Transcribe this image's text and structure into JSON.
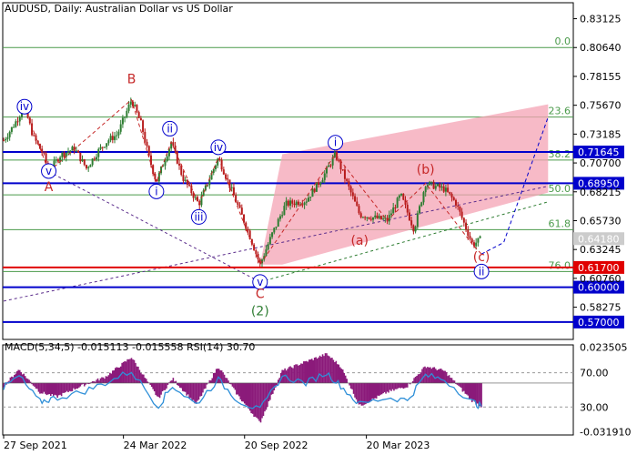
{
  "header": {
    "symbol_line": "AUDUSD, Daily:  Australian Dollar vs US Dollar",
    "indicator_line": "MACD(5,34,5) -0.015113 -0.015558 RSI(14) 30.70"
  },
  "colors": {
    "candle_up": "#2e7d32",
    "candle_down": "#b71c1c",
    "blue_level": "#0000cc",
    "red_level": "#e00000",
    "fib_level": "#4a9a4a",
    "channel": "#f4a3b4",
    "wave_blue": "#0000cc",
    "wave_red": "#c62828",
    "wave_green": "#2e7d32",
    "macd_hist": "#8b1a7a",
    "rsi_line": "#2e8fd8"
  },
  "chart_data": {
    "type": "candlestick",
    "title": "AUDUSD, Daily:  Australian Dollar vs US Dollar",
    "ylim": [
      0.555,
      0.845
    ],
    "y_ticks": [
      "0.83125",
      "0.80640",
      "0.78155",
      "0.75670",
      "0.73185",
      "0.70700",
      "0.68215",
      "0.65730",
      "0.63245",
      "0.60760",
      "0.58275"
    ],
    "x_ticks": [
      "27 Sep 2021",
      "24 Mar 2022",
      "20 Sep 2022",
      "20 Mar 2023"
    ],
    "x_range": [
      "2021-09-27",
      "2023-09-15"
    ],
    "current_price": "0.64180",
    "blue_levels": [
      "0.71645",
      "0.68950",
      "0.60000",
      "0.57000"
    ],
    "red_levels": [
      "0.61700"
    ],
    "fib_levels": [
      {
        "label": "0.0",
        "value": 0.8064
      },
      {
        "label": "23.6",
        "value": 0.7465
      },
      {
        "label": "38.2",
        "value": 0.7095
      },
      {
        "label": "50.0",
        "value": 0.6795
      },
      {
        "label": "61.8",
        "value": 0.6495
      },
      {
        "label": "76.0",
        "value": 0.6135
      }
    ],
    "wave_labels": [
      {
        "text": "iv",
        "date": "2021-10-28",
        "price": 0.7555,
        "style": "circle-blue"
      },
      {
        "text": "v",
        "date": "2021-12-03",
        "price": 0.7,
        "style": "circle-blue"
      },
      {
        "text": "A",
        "date": "2021-12-03",
        "price": 0.6865,
        "style": "red"
      },
      {
        "text": "B",
        "date": "2022-04-05",
        "price": 0.7795,
        "style": "red"
      },
      {
        "text": "ii",
        "date": "2022-06-01",
        "price": 0.7365,
        "style": "circle-blue"
      },
      {
        "text": "i",
        "date": "2022-05-12",
        "price": 0.6825,
        "style": "circle-blue"
      },
      {
        "text": "iv",
        "date": "2022-08-12",
        "price": 0.7205,
        "style": "circle-blue"
      },
      {
        "text": "iii",
        "date": "2022-07-14",
        "price": 0.6605,
        "style": "circle-blue"
      },
      {
        "text": "v",
        "date": "2022-10-13",
        "price": 0.6045,
        "style": "circle-blue"
      },
      {
        "text": "C",
        "date": "2022-10-13",
        "price": 0.5945,
        "style": "red"
      },
      {
        "text": "(2)",
        "date": "2022-10-13",
        "price": 0.5795,
        "style": "green"
      },
      {
        "text": "i",
        "date": "2023-02-02",
        "price": 0.7245,
        "style": "circle-blue"
      },
      {
        "text": "(a)",
        "date": "2023-03-10",
        "price": 0.6405,
        "style": "red"
      },
      {
        "text": "(b)",
        "date": "2023-06-16",
        "price": 0.7015,
        "style": "red"
      },
      {
        "text": "(c)",
        "date": "2023-09-07",
        "price": 0.6265,
        "style": "red"
      },
      {
        "text": "ii",
        "date": "2023-09-07",
        "price": 0.6135,
        "style": "circle-blue"
      }
    ],
    "wave_path": [
      {
        "date": "2021-10-28",
        "price": 0.7555
      },
      {
        "date": "2021-12-03",
        "price": 0.6995
      },
      {
        "date": "2022-04-05",
        "price": 0.7615
      },
      {
        "date": "2022-05-12",
        "price": 0.6905
      },
      {
        "date": "2022-06-03",
        "price": 0.725
      },
      {
        "date": "2022-07-14",
        "price": 0.6715
      },
      {
        "date": "2022-08-12",
        "price": 0.7115
      },
      {
        "date": "2022-10-13",
        "price": 0.6195
      },
      {
        "date": "2023-02-02",
        "price": 0.7145
      },
      {
        "date": "2023-04-20",
        "price": 0.6575
      },
      {
        "date": "2023-06-16",
        "price": 0.6895
      },
      {
        "date": "2023-08-25",
        "price": 0.6365
      },
      {
        "date": "2023-09-07",
        "price": 0.6285
      }
    ],
    "projection_path": [
      {
        "date": "2023-09-07",
        "price": 0.6285
      },
      {
        "date": "2023-10-10",
        "price": 0.6385
      },
      {
        "date": "2023-12-15",
        "price": 0.7465
      }
    ],
    "channel": [
      {
        "date": "2022-10-13",
        "price": 0.6195
      },
      {
        "date": "2022-11-15",
        "price": 0.7145
      },
      {
        "date": "2023-12-15",
        "price": 0.7575
      },
      {
        "date": "2023-12-15",
        "price": 0.6815
      },
      {
        "date": "2022-11-15",
        "price": 0.6195
      }
    ],
    "trend_lines": [
      {
        "from": {
          "date": "2021-09-27",
          "price": 0.588
        },
        "to": {
          "date": "2023-12-15",
          "price": 0.687
        }
      },
      {
        "from": {
          "date": "2022-10-13",
          "price": 0.6045
        },
        "to": {
          "date": "2023-12-15",
          "price": 0.6735
        }
      },
      {
        "from": {
          "date": "2021-12-03",
          "price": 0.6995
        },
        "to": {
          "date": "2022-10-13",
          "price": 0.6045
        }
      }
    ],
    "price_series": [
      {
        "date": "2021-09-27",
        "price": 0.7265
      },
      {
        "date": "2021-10-12",
        "price": 0.7395
      },
      {
        "date": "2021-10-28",
        "price": 0.7555
      },
      {
        "date": "2021-11-10",
        "price": 0.7295
      },
      {
        "date": "2021-11-25",
        "price": 0.7145
      },
      {
        "date": "2021-12-03",
        "price": 0.6995
      },
      {
        "date": "2021-12-20",
        "price": 0.7135
      },
      {
        "date": "2022-01-10",
        "price": 0.7195
      },
      {
        "date": "2022-01-28",
        "price": 0.7025
      },
      {
        "date": "2022-02-15",
        "price": 0.7175
      },
      {
        "date": "2022-03-01",
        "price": 0.7265
      },
      {
        "date": "2022-03-15",
        "price": 0.7315
      },
      {
        "date": "2022-04-05",
        "price": 0.7615
      },
      {
        "date": "2022-04-20",
        "price": 0.7395
      },
      {
        "date": "2022-05-01",
        "price": 0.7115
      },
      {
        "date": "2022-05-12",
        "price": 0.6905
      },
      {
        "date": "2022-06-03",
        "price": 0.725
      },
      {
        "date": "2022-06-20",
        "price": 0.6945
      },
      {
        "date": "2022-07-14",
        "price": 0.6715
      },
      {
        "date": "2022-08-12",
        "price": 0.7115
      },
      {
        "date": "2022-08-31",
        "price": 0.6845
      },
      {
        "date": "2022-09-25",
        "price": 0.6485
      },
      {
        "date": "2022-10-13",
        "price": 0.6195
      },
      {
        "date": "2022-10-30",
        "price": 0.6445
      },
      {
        "date": "2022-11-20",
        "price": 0.6715
      },
      {
        "date": "2022-12-20",
        "price": 0.6745
      },
      {
        "date": "2023-01-15",
        "price": 0.6955
      },
      {
        "date": "2023-02-02",
        "price": 0.7145
      },
      {
        "date": "2023-02-20",
        "price": 0.6885
      },
      {
        "date": "2023-03-10",
        "price": 0.6625
      },
      {
        "date": "2023-04-20",
        "price": 0.6575
      },
      {
        "date": "2023-05-10",
        "price": 0.6795
      },
      {
        "date": "2023-05-30",
        "price": 0.6495
      },
      {
        "date": "2023-06-16",
        "price": 0.6895
      },
      {
        "date": "2023-07-14",
        "price": 0.6845
      },
      {
        "date": "2023-07-31",
        "price": 0.6725
      },
      {
        "date": "2023-08-25",
        "price": 0.6365
      },
      {
        "date": "2023-09-07",
        "price": 0.6418
      }
    ]
  },
  "indicator_data": {
    "ylim": [
      -0.034,
      0.025
    ],
    "y_ticks": [
      "0.023505",
      "-0.031910"
    ],
    "rsi_levels": [
      "70.00",
      "30.00"
    ],
    "macd_series": [
      {
        "date": "2021-09-27",
        "v": -0.002
      },
      {
        "date": "2021-10-20",
        "v": 0.009
      },
      {
        "date": "2021-11-20",
        "v": -0.006
      },
      {
        "date": "2021-12-15",
        "v": -0.009
      },
      {
        "date": "2022-01-20",
        "v": -0.002
      },
      {
        "date": "2022-02-25",
        "v": 0.004
      },
      {
        "date": "2022-04-05",
        "v": 0.017
      },
      {
        "date": "2022-05-15",
        "v": -0.01
      },
      {
        "date": "2022-06-05",
        "v": 0.003
      },
      {
        "date": "2022-07-10",
        "v": -0.014
      },
      {
        "date": "2022-08-12",
        "v": 0.011
      },
      {
        "date": "2022-09-10",
        "v": -0.008
      },
      {
        "date": "2022-10-13",
        "v": -0.026
      },
      {
        "date": "2022-11-15",
        "v": 0.008
      },
      {
        "date": "2022-12-20",
        "v": 0.014
      },
      {
        "date": "2023-01-20",
        "v": 0.019
      },
      {
        "date": "2023-02-10",
        "v": 0.011
      },
      {
        "date": "2023-03-10",
        "v": -0.015
      },
      {
        "date": "2023-04-20",
        "v": -0.006
      },
      {
        "date": "2023-05-20",
        "v": -0.002
      },
      {
        "date": "2023-06-16",
        "v": 0.011
      },
      {
        "date": "2023-07-14",
        "v": 0.008
      },
      {
        "date": "2023-08-25",
        "v": -0.012
      },
      {
        "date": "2023-09-07",
        "v": -0.0151
      }
    ],
    "rsi_series": [
      {
        "date": "2021-09-27",
        "v": 52
      },
      {
        "date": "2021-10-20",
        "v": 66
      },
      {
        "date": "2021-11-20",
        "v": 36
      },
      {
        "date": "2021-12-10",
        "v": 40
      },
      {
        "date": "2022-01-20",
        "v": 47
      },
      {
        "date": "2022-02-25",
        "v": 58
      },
      {
        "date": "2022-04-05",
        "v": 72
      },
      {
        "date": "2022-05-15",
        "v": 31
      },
      {
        "date": "2022-06-05",
        "v": 55
      },
      {
        "date": "2022-07-10",
        "v": 33
      },
      {
        "date": "2022-08-12",
        "v": 62
      },
      {
        "date": "2022-09-10",
        "v": 38
      },
      {
        "date": "2022-10-13",
        "v": 26
      },
      {
        "date": "2022-11-15",
        "v": 66
      },
      {
        "date": "2022-12-20",
        "v": 58
      },
      {
        "date": "2023-01-20",
        "v": 70
      },
      {
        "date": "2023-02-10",
        "v": 55
      },
      {
        "date": "2023-03-10",
        "v": 33
      },
      {
        "date": "2023-04-20",
        "v": 41
      },
      {
        "date": "2023-05-20",
        "v": 38
      },
      {
        "date": "2023-06-16",
        "v": 67
      },
      {
        "date": "2023-07-14",
        "v": 62
      },
      {
        "date": "2023-08-25",
        "v": 36
      },
      {
        "date": "2023-09-07",
        "v": 30.7
      }
    ]
  }
}
